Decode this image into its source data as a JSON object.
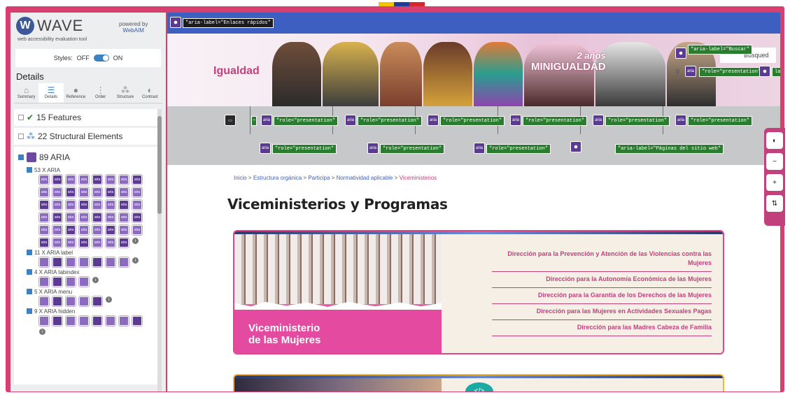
{
  "wave": {
    "logo_text": "WAVE",
    "logo_sub": "web accessibility evaluation tool",
    "powered_by": "powered by",
    "webaim": "WebAIM",
    "styles_label": "Styles:",
    "off": "OFF",
    "on": "ON",
    "details_heading": "Details",
    "tabs": [
      {
        "label": "Summary",
        "icon": "flag-icon"
      },
      {
        "label": "Details",
        "icon": "list-icon"
      },
      {
        "label": "Reference",
        "icon": "info-icon"
      },
      {
        "label": "Order",
        "icon": "order-icon"
      },
      {
        "label": "Structure",
        "icon": "structure-icon"
      },
      {
        "label": "Contrast",
        "icon": "contrast-icon"
      }
    ],
    "features": "15 Features",
    "structural": "22 Structural Elements",
    "aria": "89 ARIA",
    "subs": [
      {
        "label": "53 X ARIA",
        "count": 53
      },
      {
        "label": "11 X ARIA label",
        "count": 11
      },
      {
        "label": "4 X ARIA tabindex",
        "count": 4
      },
      {
        "label": "5 X ARIA menu",
        "count": 5
      },
      {
        "label": "9 X ARIA hidden",
        "count": 9
      }
    ],
    "aria_icon_text": "aria"
  },
  "site": {
    "skip_label": "\"aria-label=\"Enlaces rápidos\"",
    "brand": "Igualdad",
    "campaign_top": "2 años",
    "campaign": "MINIGUALDAD",
    "search_label": "\"aria-label=\"Buscar\"",
    "search_placeholder": "Búsqued",
    "role_presentation": "\"role=\"presentation\"",
    "aria": "aria",
    "site_pages_label": "\"aria-label=\"Páginas del sitio web\"",
    "label_cut": "label=",
    "breadcrumb": [
      "Inicio",
      "Estructura orgánica",
      "Participa",
      "Normatividad aplicable"
    ],
    "breadcrumb_current": "Viceministerios",
    "page_title": "Viceministerios y Programas",
    "card_title_line1": "Viceministerio",
    "card_title_line2": "de las Mujeres",
    "card_links": [
      "Dirección para la Prevención y Atención de las Violencias contra las Mujeres",
      "Dirección para la Autonomía Económica de las Mujeres",
      "Dirección para la Garantía de los Derechos de las Mujeres",
      "Dirección para las Mujeres en Actividades Sexuales Pagas",
      "Dirección para las Madres Cabeza de Familia"
    ],
    "code_icon": "</>"
  },
  "colors": {
    "accent": "#c2417d",
    "wave_blue": "#3b5998",
    "topbar": "#3d5fc2"
  }
}
